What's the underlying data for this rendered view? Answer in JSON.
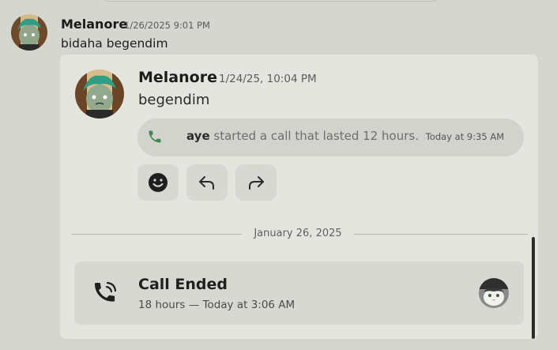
{
  "outer_message": {
    "author": "Melanore",
    "timestamp": "1/26/2025 9:01 PM",
    "text": "bidaha begendim",
    "avatar_icon": "cartoon-avatar-icon"
  },
  "forwarded_message": {
    "author": "Melanore",
    "timestamp": "1/24/25, 10:04 PM",
    "text": "begendim",
    "avatar_icon": "cartoon-avatar-icon",
    "call_notice": {
      "user": "aye",
      "text": "started a call that lasted 12 hours.",
      "time": "Today at 9:35 AM",
      "icon": "phone-icon"
    },
    "actions": [
      {
        "icon": "emoji-reaction-icon"
      },
      {
        "icon": "reply-icon"
      },
      {
        "icon": "forward-icon"
      }
    ]
  },
  "date_divider": "January 26, 2025",
  "call_card": {
    "title": "Call Ended",
    "subtitle": "18 hours — Today at 3:06 AM",
    "icon": "phone-call-icon",
    "participant_icon": "cat-avatar-icon"
  },
  "colors": {
    "background": "#d6d6d0",
    "embed": "#e5e5e0",
    "pill": "#d3d3ce",
    "accent_green": "#3c8a4c",
    "hair_teal": "#2e9e84"
  }
}
